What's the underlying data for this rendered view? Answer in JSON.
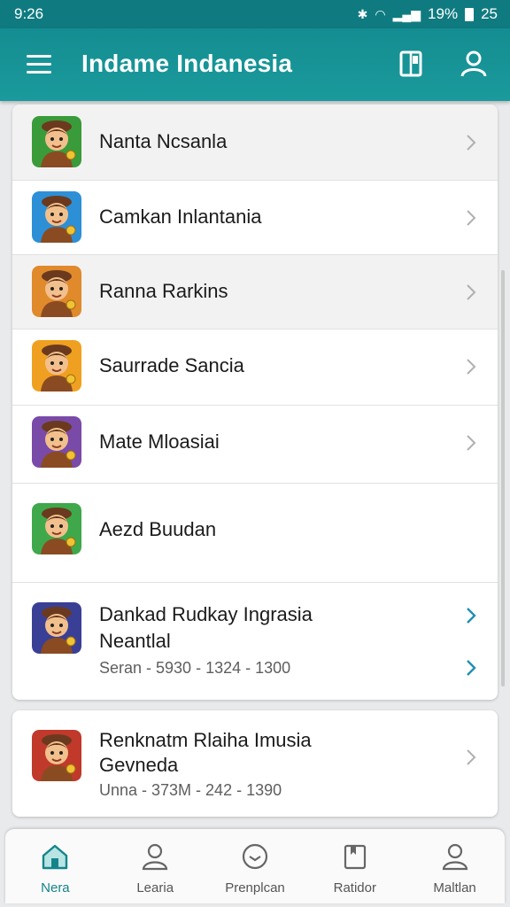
{
  "status_bar": {
    "time": "9:26",
    "battery": "19%",
    "extra": "25"
  },
  "app_bar": {
    "title": "Indame Indanesia"
  },
  "colors": {
    "accent": "#148d91",
    "chevron": "#b0b0b0",
    "chevron_active": "#1f8fb4"
  },
  "list": [
    {
      "title": "Nanta Ncsanla",
      "avatar_bg": "#3a9b3a",
      "icon": "character-avatar-icon"
    },
    {
      "title": "Camkan Inlantania",
      "avatar_bg": "#2d8fd6",
      "icon": "character-avatar-icon"
    },
    {
      "title": "Ranna Rarkins",
      "avatar_bg": "#e08a2c",
      "icon": "character-avatar-icon"
    },
    {
      "title": "Saurrade Sancia",
      "avatar_bg": "#f0a020",
      "icon": "character-avatar-icon"
    },
    {
      "title": "Mate Mloasiai",
      "avatar_bg": "#7a4aa8",
      "icon": "character-avatar-icon"
    },
    {
      "title": "Aezd Buudan",
      "avatar_bg": "#3fa84a",
      "icon": "character-avatar-icon"
    },
    {
      "title": "Dankad Rudkay Ingrasia",
      "title_line2": "Neantlal",
      "subtitle": "Seran - 5930 - 1324 - 1300",
      "avatar_bg": "#3a3f96",
      "icon": "character-avatar-icon"
    }
  ],
  "second_card": {
    "title": "Renknatm Rlaiha Imusia",
    "title_line2": "Gevneda",
    "subtitle": "Unna - 373M - 242 - 1390",
    "avatar_bg": "#c0392b",
    "icon": "character-avatar-icon"
  },
  "bottom_nav": [
    {
      "label": "Nera",
      "icon": "home-icon",
      "active": true
    },
    {
      "label": "Learia",
      "icon": "person-icon",
      "active": false
    },
    {
      "label": "Prenplcan",
      "icon": "clock-icon",
      "active": false
    },
    {
      "label": "Ratidor",
      "icon": "bookmark-icon",
      "active": false
    },
    {
      "label": "Maltlan",
      "icon": "profile-icon",
      "active": false
    }
  ]
}
